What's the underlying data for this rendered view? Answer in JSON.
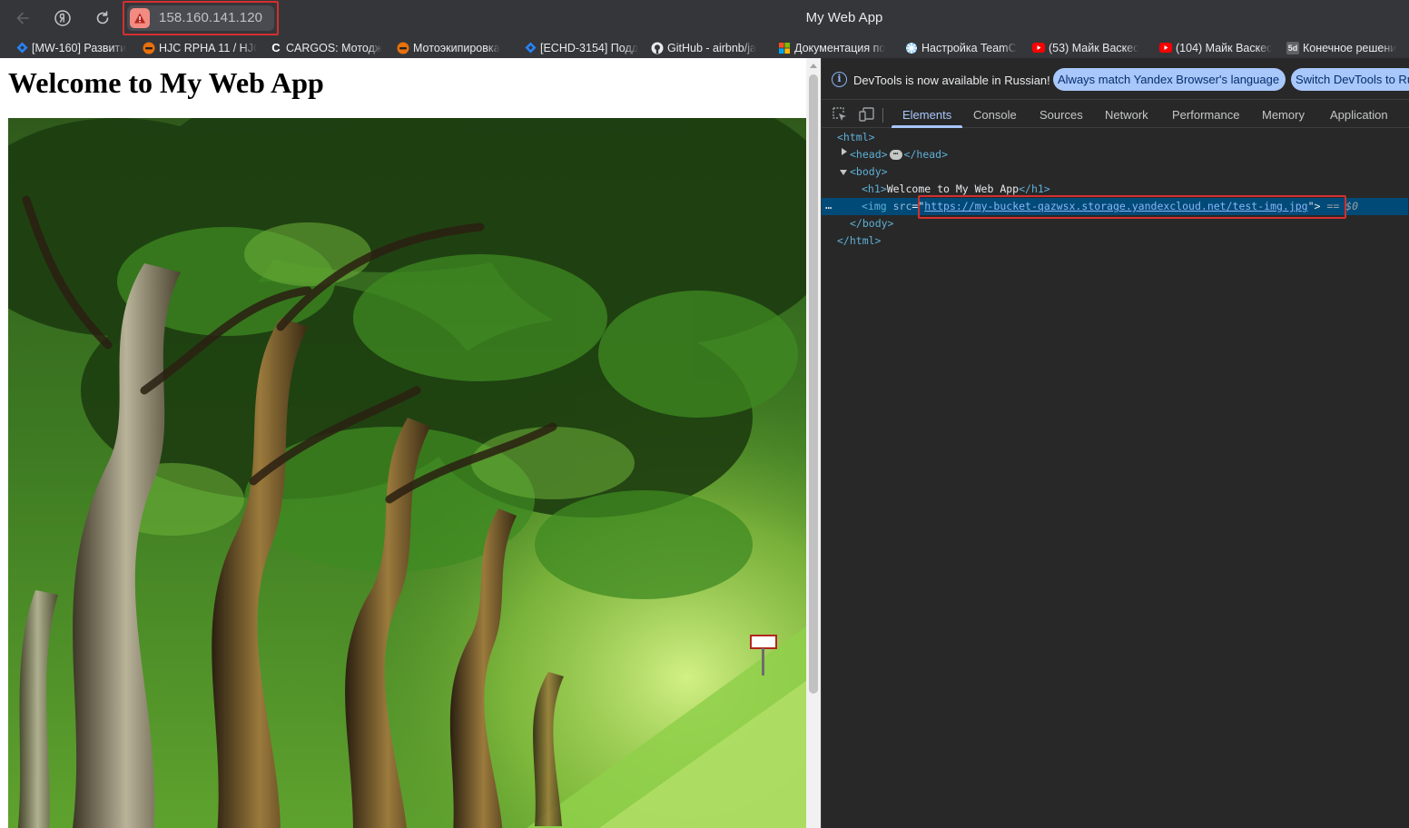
{
  "browser": {
    "address": "158.160.141.120",
    "window_title": "My Web App",
    "icons": {
      "back": "arrow-left-icon",
      "yandex": "yandex-logo-icon",
      "reload": "reload-icon",
      "warning": "warning-triangle-icon"
    }
  },
  "bookmarks": [
    {
      "label": "[MW-160] Развити",
      "icon": "jira-diamond-icon"
    },
    {
      "label": "HJC RPHA 11 / HJC",
      "icon": "moto-helmet-icon"
    },
    {
      "label": "CARGOS: Мотодж",
      "icon": "cargos-c-icon"
    },
    {
      "label": "Мотоэкипировка",
      "icon": "moto-helmet-icon"
    },
    {
      "label": "[ECHD-3154] Подд",
      "icon": "jira-diamond-icon"
    },
    {
      "label": "GitHub - airbnb/ja",
      "icon": "github-icon"
    },
    {
      "label": "Документация по",
      "icon": "microsoft-icon"
    },
    {
      "label": "Настройка TeamC",
      "icon": "teamcity-icon"
    },
    {
      "label": "(53) Майк Васкес",
      "icon": "youtube-icon"
    },
    {
      "label": "(104) Майк Васкес",
      "icon": "youtube-icon"
    },
    {
      "label": "Конечное решени",
      "icon": "5d-icon",
      "icon_text": "5d"
    }
  ],
  "page": {
    "heading": "Welcome to My Web App",
    "image_alt": "forest-alley-photo"
  },
  "devtools": {
    "info_text": "DevTools is now available in Russian!",
    "btn_match": "Always match Yandex Browser's language",
    "btn_switch": "Switch DevTools to Ru",
    "tabs": [
      "Elements",
      "Console",
      "Sources",
      "Network",
      "Performance",
      "Memory",
      "Application"
    ],
    "active_tab": "Elements",
    "dom": {
      "html_open": "<html>",
      "head_open": "<head>",
      "head_close": "</head>",
      "body_open": "<body>",
      "h1_open": "<h1>",
      "h1_text": "Welcome to My Web App",
      "h1_close": "</h1>",
      "img_open": "<img ",
      "img_attr": "src",
      "img_eq": "=\"",
      "img_url": "https://my-bucket-qazwsx.storage.yandexcloud.net/test-img.jpg",
      "img_close": "\">",
      "selected_marker": "== $0",
      "body_close": "</body>",
      "html_close": "</html>",
      "dots": "…",
      "ellipsis": "…"
    }
  },
  "colors": {
    "titlebar": "#35363a",
    "devtools_bg": "#282828",
    "accent": "#a8c7fa",
    "highlight_box": "#d32f2f",
    "selected_row": "#004a77"
  }
}
